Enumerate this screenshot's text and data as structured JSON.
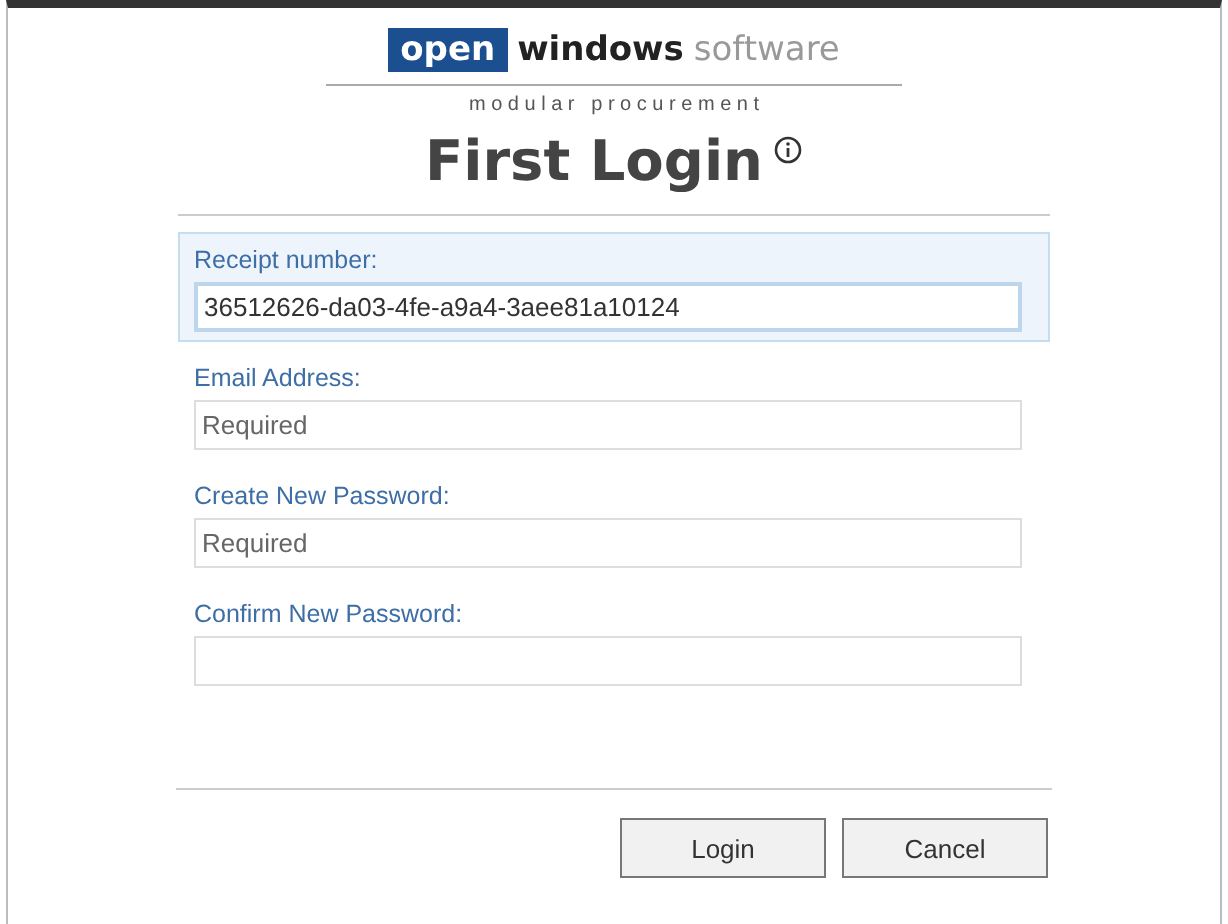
{
  "logo": {
    "brand_box": "open",
    "brand_bold": "windows",
    "brand_light": "software",
    "tagline": "m o d u l a r   p r o c u r e m e n t"
  },
  "title": "First Login",
  "fields": [
    {
      "label": "Receipt number:",
      "value": "36512626-da03-4fe-a9a4-3aee81a10124",
      "focused": true
    },
    {
      "label": "Email Address:",
      "placeholder": "Required",
      "focused": false
    },
    {
      "label": "Create New Password:",
      "placeholder": "Required",
      "focused": false
    },
    {
      "label": "Confirm New Password:",
      "focused": false
    }
  ],
  "buttons": [
    "Login",
    "Cancel"
  ]
}
